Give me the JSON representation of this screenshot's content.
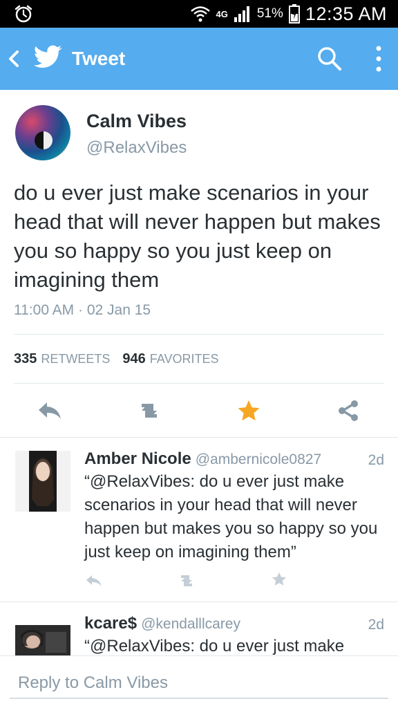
{
  "status_bar": {
    "network": "4G",
    "battery": "51%",
    "time": "12:35 AM"
  },
  "app_bar": {
    "title": "Tweet"
  },
  "tweet": {
    "author_name": "Calm Vibes",
    "author_handle": "@RelaxVibes",
    "text": "do u ever just make scenarios in your head that will never happen but makes you so happy so you just keep on imagining them",
    "timestamp": "11:00 AM · 02 Jan 15",
    "retweets_count": "335",
    "retweets_label": "RETWEETS",
    "favorites_count": "946",
    "favorites_label": "FAVORITES",
    "favorited": true
  },
  "replies": [
    {
      "name": "Amber Nicole",
      "handle": "@ambernicole0827",
      "age": "2d",
      "text": "“@RelaxVibes: do u ever just make scenarios in your head that will never happen but makes you so happy so you just keep on imagining them”"
    },
    {
      "name": "kcare$",
      "handle": "@kendalllcarey",
      "age": "2d",
      "text": "“@RelaxVibes: do u ever just make"
    }
  ],
  "reply_box": {
    "placeholder": "Reply to Calm Vibes"
  },
  "colors": {
    "twitter_blue": "#55acee",
    "favorite_star": "#f5a623",
    "icon_gray": "#8899a6"
  }
}
